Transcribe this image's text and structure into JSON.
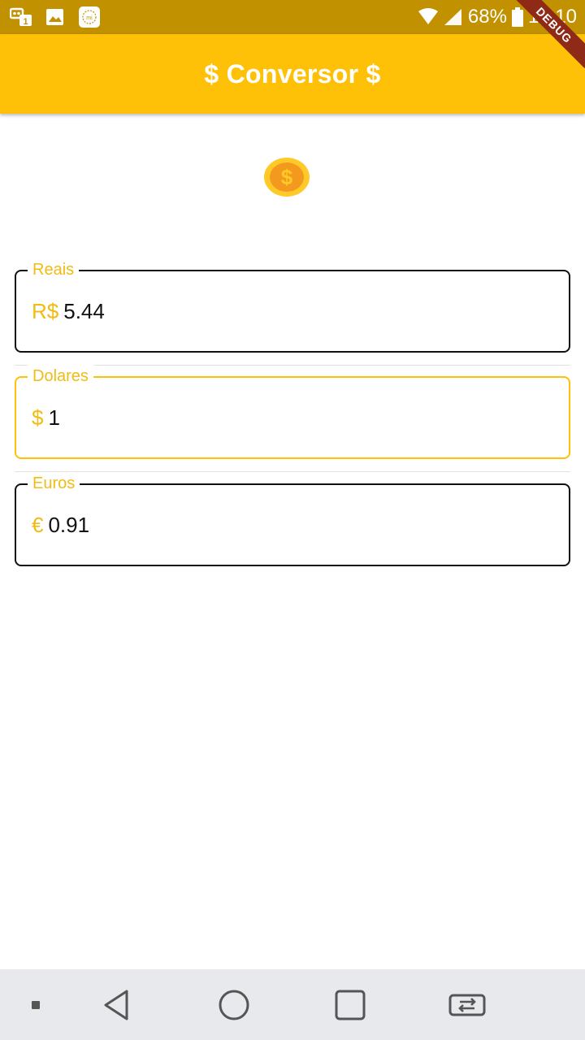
{
  "status_bar": {
    "battery": "68%",
    "time": "10:10",
    "icons": [
      "chat-icon",
      "image-icon",
      "mi-icon",
      "wifi-icon",
      "signal-icon",
      "battery-icon"
    ]
  },
  "debug_banner": "DEBUG",
  "app_bar": {
    "title": "$ Conversor $"
  },
  "logo": {
    "icon": "coin-dollar-icon",
    "glyph": "$"
  },
  "fields": {
    "reais": {
      "label": "Reais",
      "prefix": "R$",
      "value": "5.44"
    },
    "dolares": {
      "label": "Dolares",
      "prefix": "$",
      "value": "1"
    },
    "euros": {
      "label": "Euros",
      "prefix": "€",
      "value": "0.91"
    }
  },
  "colors": {
    "status_bar": "#C29100",
    "app_bar": "#FFC107",
    "accent": "#F2BB12",
    "nav_bar": "#E8E9EC"
  },
  "nav_bar": {
    "icons": [
      "menu-dot-icon",
      "back-icon",
      "home-icon",
      "recents-icon",
      "switch-app-icon"
    ]
  }
}
